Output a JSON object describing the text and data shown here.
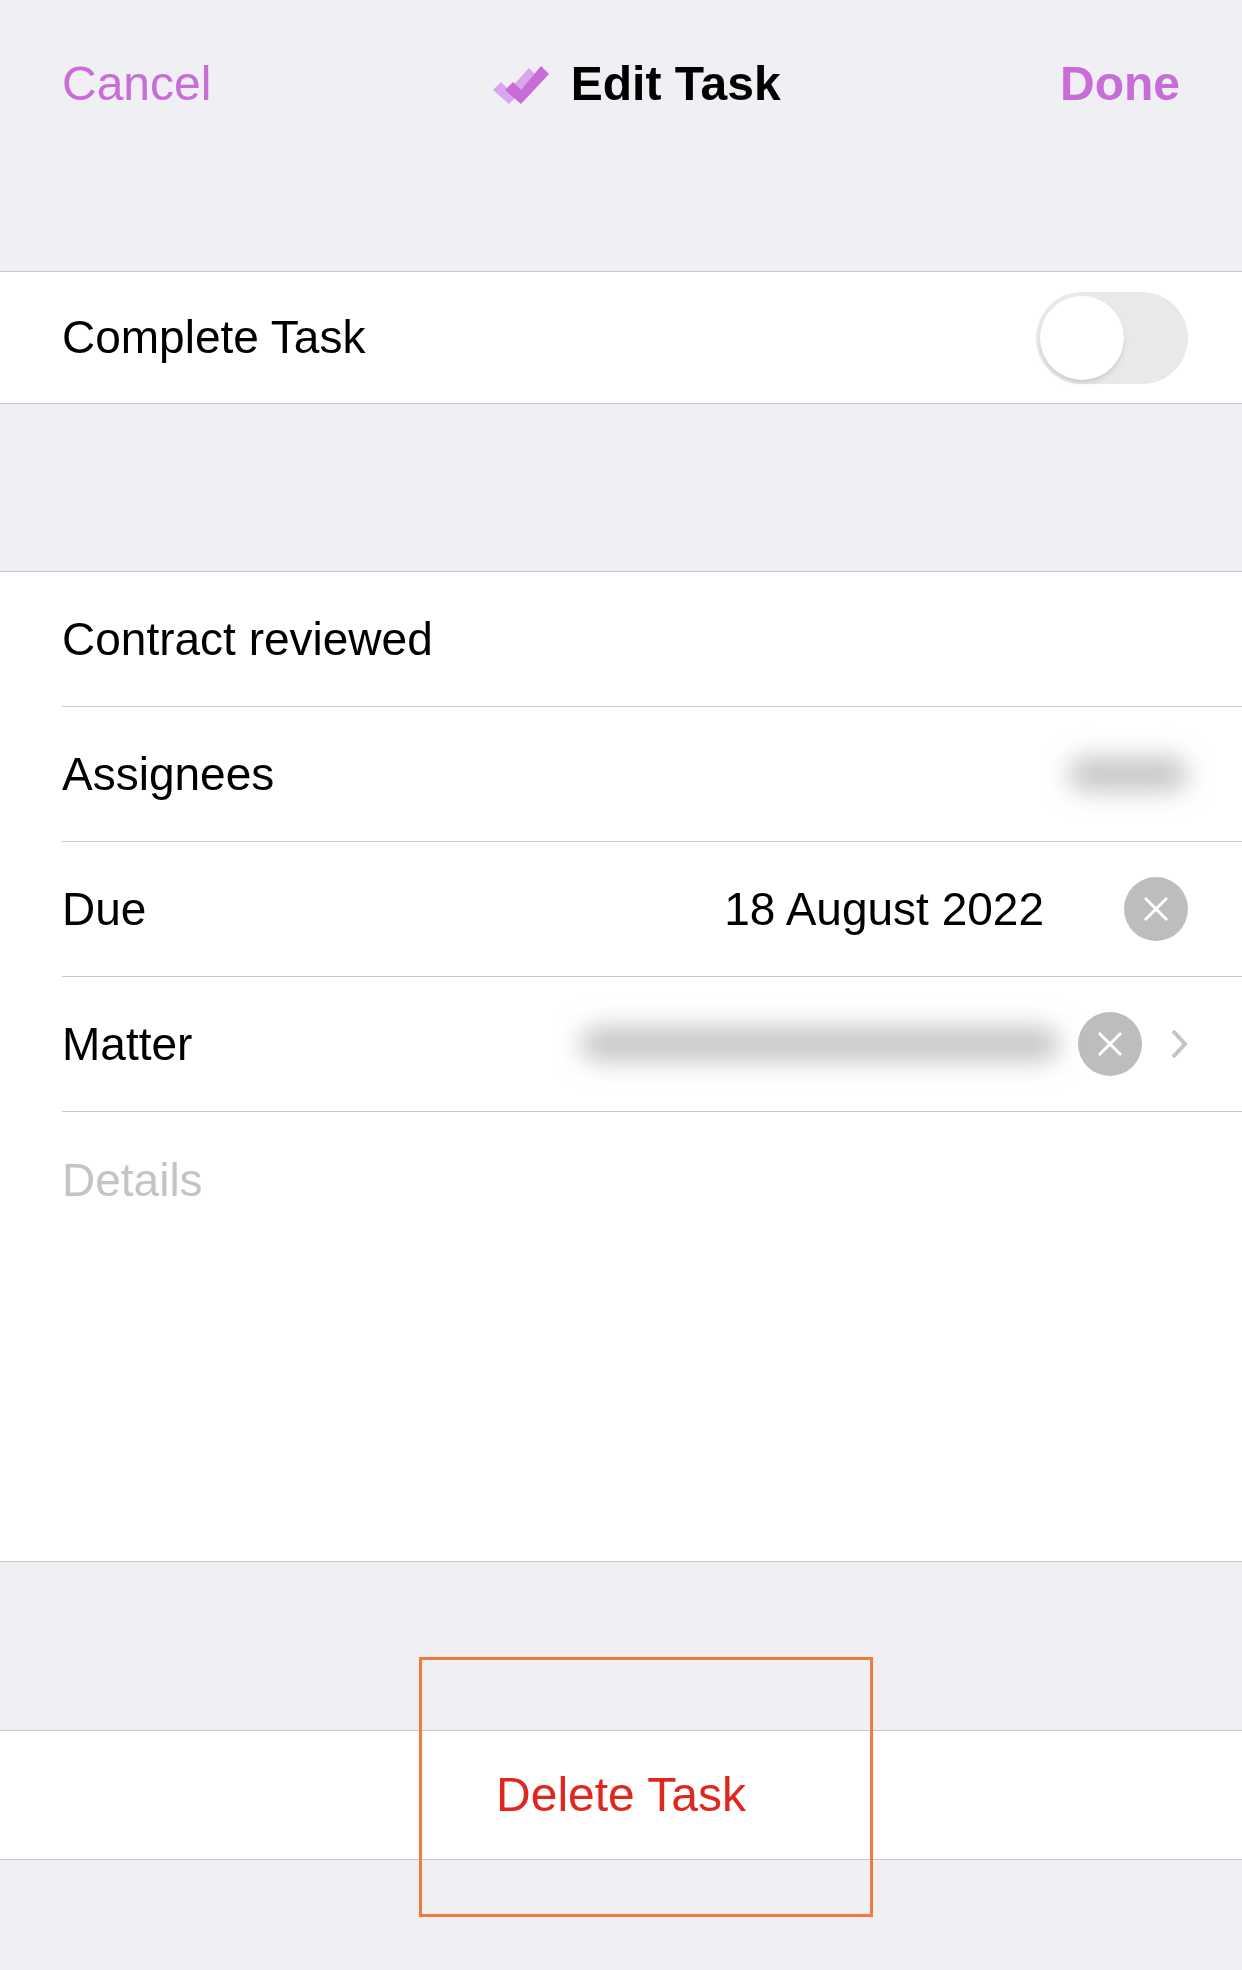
{
  "nav": {
    "cancel": "Cancel",
    "title": "Edit Task",
    "done": "Done"
  },
  "complete": {
    "label": "Complete Task",
    "on": false
  },
  "fields": [
    {
      "kind": "title",
      "value": "Contract reviewed"
    },
    {
      "kind": "detail",
      "label": "Assignees",
      "redacted": true
    },
    {
      "kind": "detail",
      "label": "Due",
      "value": "18 August 2022",
      "clearable": true
    },
    {
      "kind": "detail",
      "label": "Matter",
      "redacted": true,
      "clearable": true,
      "chevron": true
    }
  ],
  "details": {
    "placeholder": "Details"
  },
  "delete": {
    "label": "Delete Task",
    "highlighted": true
  }
}
